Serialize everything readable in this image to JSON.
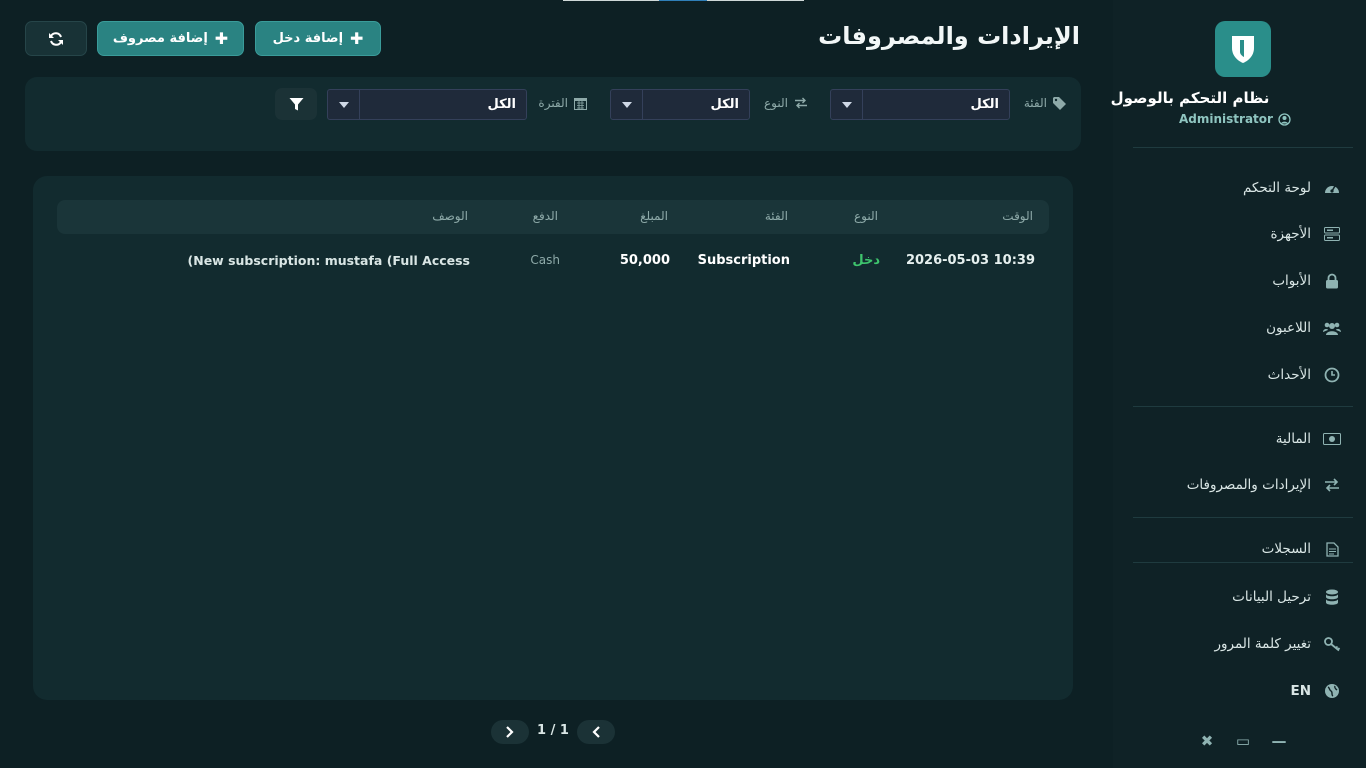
{
  "app": {
    "title": "نظام التحكم بالوصول",
    "user": "Administrator"
  },
  "nav": {
    "dashboard": "لوحة التحكم",
    "devices": "الأجهزة",
    "doors": "الأبواب",
    "players": "اللاعبون",
    "events": "الأحداث",
    "finance": "المالية",
    "income_expenses": "الإيرادات والمصروفات",
    "logs": "السجلات",
    "migration": "ترحيل البيانات",
    "change_password": "تغيير كلمة المرور",
    "language": "EN"
  },
  "window_controls": {
    "close": "✖",
    "maximize": "▭",
    "minimize": "—"
  },
  "page": {
    "title": "الإيرادات والمصروفات",
    "add_income": "إضافة دخل",
    "add_expense": "إضافة مصروف"
  },
  "filters": {
    "category_label": "الفئة",
    "category_value": "الكل",
    "type_label": "النوع",
    "type_value": "الكل",
    "period_label": "الفترة",
    "period_value": "الكل"
  },
  "table": {
    "headers": {
      "time": "الوقت",
      "type": "النوع",
      "category": "الفئة",
      "amount": "المبلغ",
      "payment": "الدفع",
      "description": "الوصف"
    },
    "rows": [
      {
        "time": "2026-05-03 10:39",
        "type": "دخل",
        "category": "Subscription",
        "amount": "50,000",
        "payment": "Cash",
        "description": "(New subscription: mustafa (Full Access"
      }
    ]
  },
  "pagination": {
    "text": "1 / 1"
  },
  "colors": {
    "background": "#0d2024",
    "accent": "#2a8382",
    "income_text": "#3ec46d",
    "select_bg": "#1f2a3a"
  }
}
